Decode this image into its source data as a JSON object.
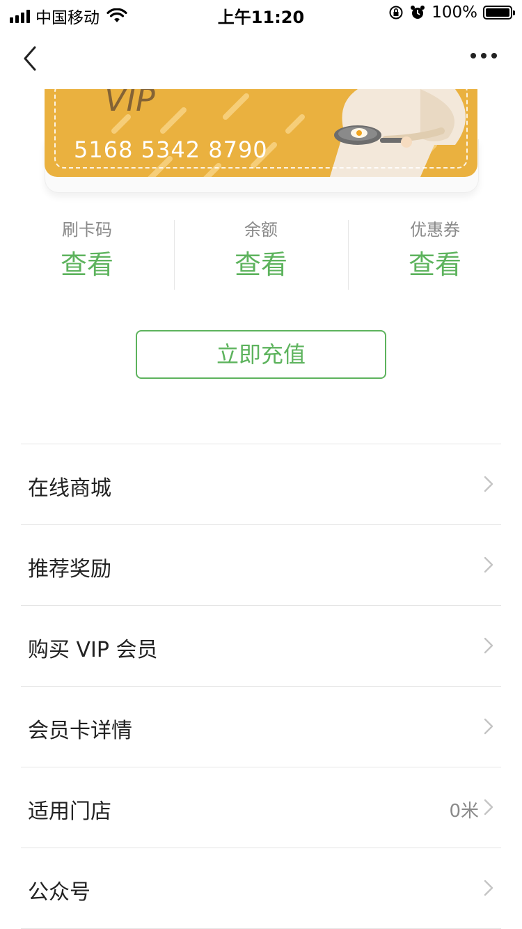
{
  "status_bar": {
    "carrier": "中国移动",
    "time": "上午11:20",
    "battery": "100%",
    "battery_level": 1.0
  },
  "card": {
    "number": "5168 5342 8790",
    "brand_fragment": "VIP",
    "colors": {
      "background": "#eab13f"
    }
  },
  "stats": [
    {
      "label": "刷卡码",
      "value": "查看"
    },
    {
      "label": "余额",
      "value": "查看"
    },
    {
      "label": "优惠券",
      "value": "查看"
    }
  ],
  "recharge_button": "立即充值",
  "menu": [
    {
      "label": "在线商城",
      "extra": ""
    },
    {
      "label": "推荐奖励",
      "extra": ""
    },
    {
      "label": "购买 VIP 会员",
      "extra": ""
    },
    {
      "label": "会员卡详情",
      "extra": ""
    },
    {
      "label": "适用门店",
      "extra": "0米"
    },
    {
      "label": "公众号",
      "extra": ""
    }
  ],
  "icons": {
    "back": "chevron-left-icon",
    "more": "more-dots-icon",
    "row": "chevron-right-icon"
  },
  "colors": {
    "accent": "#5db35d",
    "text": "#222222",
    "muted": "#8a8a8a"
  }
}
